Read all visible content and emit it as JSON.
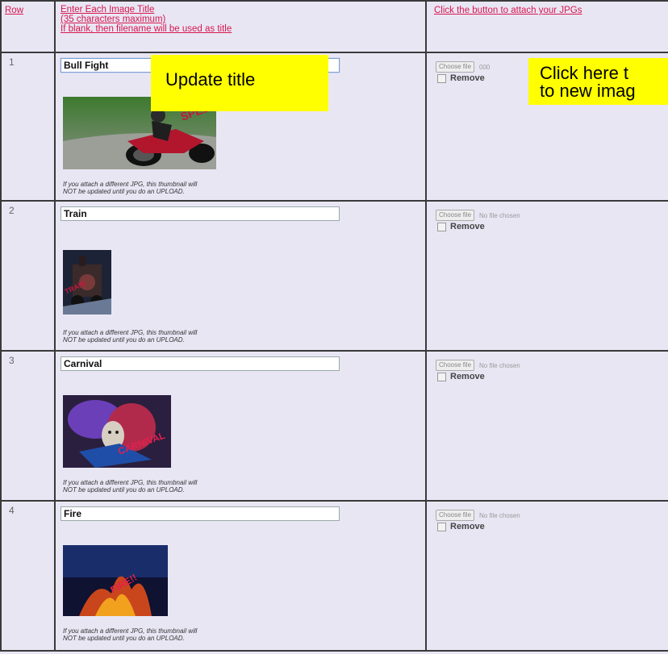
{
  "header": {
    "row": "Row",
    "title_line1": "Enter Each Image Title",
    "title_line2": "(35 characters maximum)",
    "title_line3": "If blank, then filename will be used as title",
    "attach": "Click the button to attach your JPGs"
  },
  "thumb_note_line1": "If you attach a different JPG, this thumbnail will",
  "thumb_note_line2": "NOT be updated until you do an UPLOAD.",
  "choose_label": "Choose file",
  "remove_label": "Remove",
  "rows": [
    {
      "num": "1",
      "title": "Bull Fight",
      "file_status": "000"
    },
    {
      "num": "2",
      "title": "Train",
      "file_status": "No file chosen"
    },
    {
      "num": "3",
      "title": "Carnival",
      "file_status": "No file chosen"
    },
    {
      "num": "4",
      "title": "Fire",
      "file_status": "No file chosen"
    }
  ],
  "callouts": {
    "update_title": "Update title",
    "click_here_line1": "Click here t",
    "click_here_line2": "to new imag"
  },
  "colors": {
    "link": "#d6184e",
    "background": "#e9e6f4",
    "callout": "#ffff00"
  }
}
